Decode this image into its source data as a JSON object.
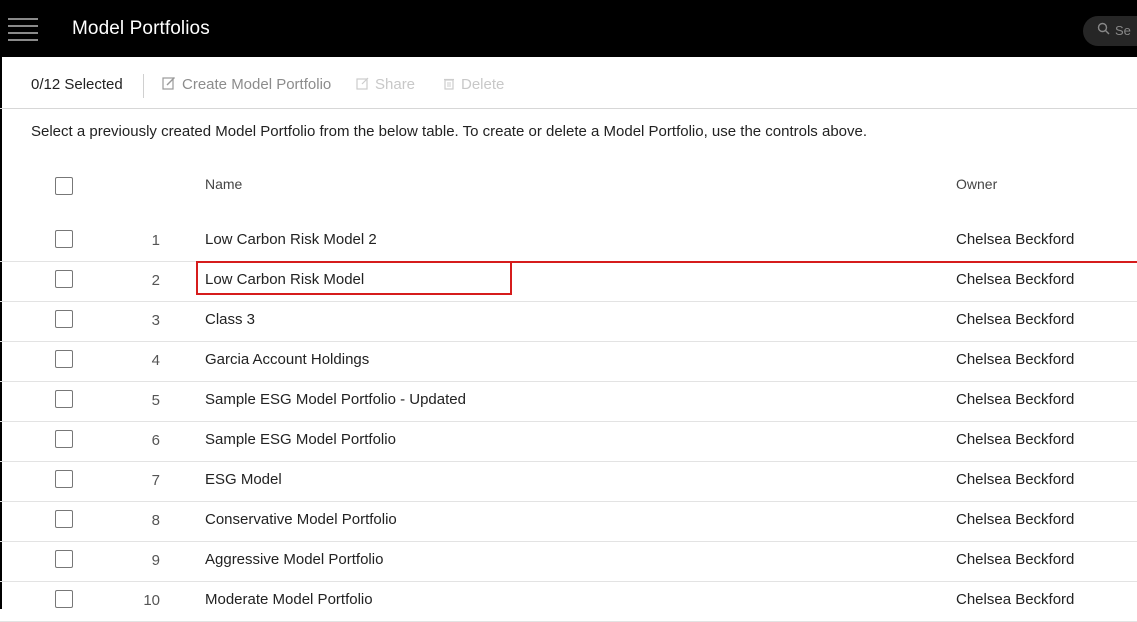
{
  "header": {
    "title": "Model Portfolios",
    "menu_icon": "hamburger-menu-icon",
    "search_icon": "search-icon",
    "search_placeholder": "Se"
  },
  "toolbar": {
    "selected_count": "0/12 Selected",
    "create_label": "Create Model Portfolio",
    "create_icon": "edit-icon",
    "share_label": "Share",
    "share_icon": "share-icon",
    "delete_label": "Delete",
    "delete_icon": "trash-icon"
  },
  "instructions": "Select a previously created Model Portfolio from the below table. To create or delete a Model Portfolio, use the controls above.",
  "table": {
    "columns": {
      "name": "Name",
      "owner": "Owner"
    },
    "rows": [
      {
        "num": "1",
        "name": "Low Carbon Risk Model 2",
        "owner": "Chelsea Beckford"
      },
      {
        "num": "2",
        "name": "Low Carbon Risk Model",
        "owner": "Chelsea Beckford"
      },
      {
        "num": "3",
        "name": "Class 3",
        "owner": "Chelsea Beckford"
      },
      {
        "num": "4",
        "name": "Garcia Account Holdings",
        "owner": "Chelsea Beckford"
      },
      {
        "num": "5",
        "name": "Sample ESG Model Portfolio - Updated",
        "owner": "Chelsea Beckford"
      },
      {
        "num": "6",
        "name": "Sample ESG Model Portfolio",
        "owner": "Chelsea Beckford"
      },
      {
        "num": "7",
        "name": "ESG Model",
        "owner": "Chelsea Beckford"
      },
      {
        "num": "8",
        "name": "Conservative Model Portfolio",
        "owner": "Chelsea Beckford"
      },
      {
        "num": "9",
        "name": "Aggressive Model Portfolio",
        "owner": "Chelsea Beckford"
      },
      {
        "num": "10",
        "name": "Moderate Model Portfolio",
        "owner": "Chelsea Beckford"
      }
    ]
  },
  "colors": {
    "highlight": "#d61c1c",
    "header_bg": "#000000"
  }
}
